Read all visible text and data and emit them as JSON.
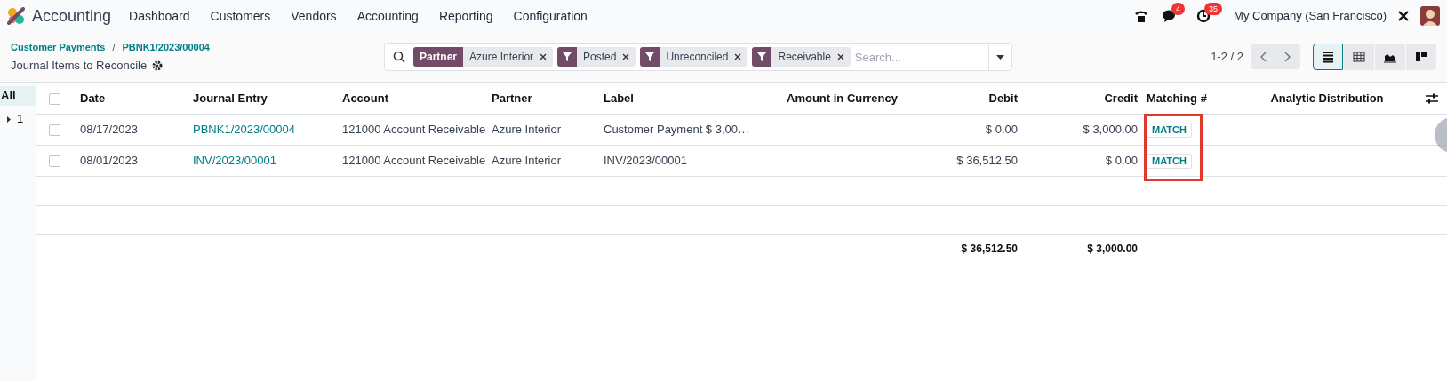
{
  "navbar": {
    "app_name": "Accounting",
    "menu": [
      "Dashboard",
      "Customers",
      "Vendors",
      "Accounting",
      "Reporting",
      "Configuration"
    ],
    "messages_count": "4",
    "activities_count": "35",
    "company": "My Company (San Francisco)"
  },
  "breadcrumb": [
    "Customer Payments",
    "PBNK1/2023/00004"
  ],
  "breadcrumb_separator": "/",
  "page_title": "Journal Items to Reconcile",
  "search": {
    "facets": [
      {
        "kind": "field",
        "label": "Partner",
        "value": "Azure Interior"
      },
      {
        "kind": "filter",
        "value": "Posted"
      },
      {
        "kind": "filter",
        "value": "Unreconciled"
      },
      {
        "kind": "filter",
        "value": "Receivable"
      }
    ],
    "placeholder": "Search..."
  },
  "pager": "1-2 / 2",
  "views": [
    {
      "kind": "list",
      "selected": true
    },
    {
      "kind": "pivot",
      "selected": false
    },
    {
      "kind": "graph",
      "selected": false
    },
    {
      "kind": "kanban",
      "selected": false
    }
  ],
  "side_panel": {
    "items": [
      {
        "label": "All",
        "selected": true,
        "expandable": false
      },
      {
        "label": "1",
        "selected": false,
        "expandable": true
      }
    ]
  },
  "table": {
    "select_all_checked": false,
    "columns": [
      "Date",
      "Journal Entry",
      "Account",
      "Partner",
      "Label",
      "Amount in Currency",
      "Debit",
      "Credit",
      "Matching #",
      "Analytic Distribution"
    ],
    "rows": [
      {
        "checked": false,
        "date": "08/17/2023",
        "journal_entry": "PBNK1/2023/00004",
        "account": "121000 Account Receivable",
        "partner": "Azure Interior",
        "label": "Customer Payment $ 3,00…",
        "debit": "$ 0.00",
        "credit": "$ 3,000.00",
        "matching": "MATCH"
      },
      {
        "checked": false,
        "date": "08/01/2023",
        "journal_entry": "INV/2023/00001",
        "account": "121000 Account Receivable",
        "partner": "Azure Interior",
        "label": "INV/2023/00001",
        "debit": "$ 36,512.50",
        "credit": "$ 0.00",
        "matching": "MATCH"
      }
    ],
    "totals": {
      "debit": "$ 36,512.50",
      "credit": "$ 3,000.00"
    }
  }
}
